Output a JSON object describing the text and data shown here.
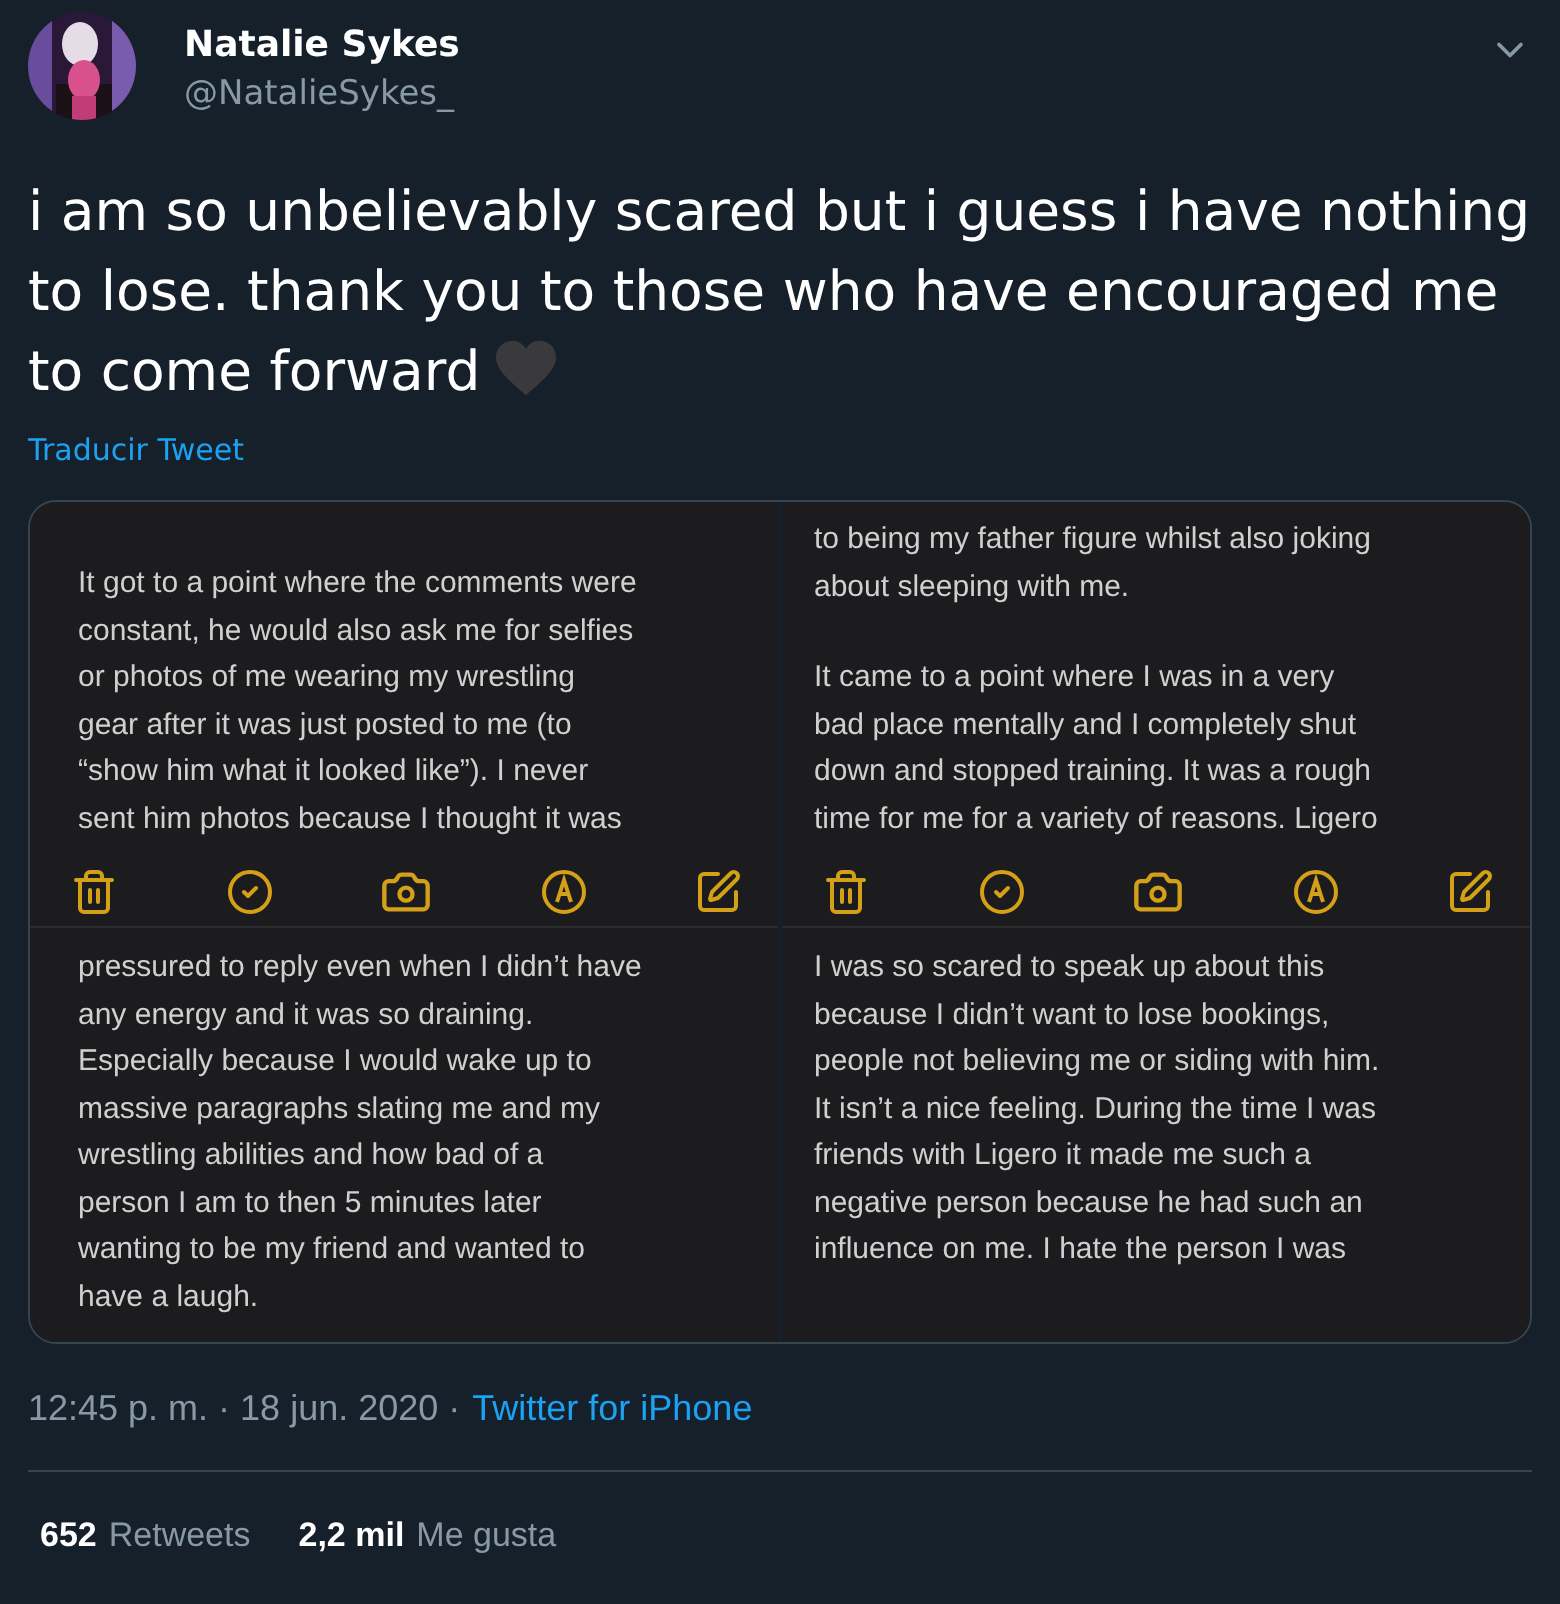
{
  "author": {
    "name": "Natalie Sykes",
    "handle": "@NatalieSykes_"
  },
  "tweet": {
    "text": "i am so unbelievably scared but i guess i have nothing to lose. thank you to those who have encouraged me to come forward",
    "translate_link": "Traducir Tweet"
  },
  "media": [
    {
      "top": [
        [
          "It got to a point where the comments were",
          "constant, he would also ask me for selfies",
          "or photos of me wearing my wrestling",
          "gear after it was just posted to me (to",
          "“show him what it looked like”). I never",
          "sent him photos because I thought it was"
        ]
      ],
      "bottom": [
        [
          "pressured to reply even when I didn’t have",
          "any energy and it was so draining.",
          "Especially because I would wake up to",
          "massive paragraphs slating me and my",
          "wrestling abilities and how bad of a",
          "person I am to then 5 minutes later",
          "wanting to be my friend and wanted to",
          "have a laugh."
        ]
      ]
    },
    {
      "top": [
        [
          "to being my father figure whilst also joking",
          "about sleeping with me."
        ],
        [
          "It came to a point where I was in a very",
          "bad place mentally and I completely shut",
          "down and stopped training. It was a rough",
          "time for me for a variety of reasons. Ligero"
        ]
      ],
      "bottom": [
        [
          "I was so scared to speak up about this",
          "because I didn’t want to lose bookings,",
          "people not believing me or siding with him.",
          "It isn’t a nice feeling. During the time I was",
          "friends with Ligero it made me such a",
          "negative person because he had such an",
          "influence on me. I hate the person I was"
        ]
      ]
    }
  ],
  "meta": {
    "timestamp": "12:45 p. m. · 18 jun. 2020 ·",
    "source": "Twitter for iPhone"
  },
  "stats": [
    {
      "count": "652",
      "label": "Retweets"
    },
    {
      "count": "2,2 mil",
      "label": "Me gusta"
    }
  ]
}
